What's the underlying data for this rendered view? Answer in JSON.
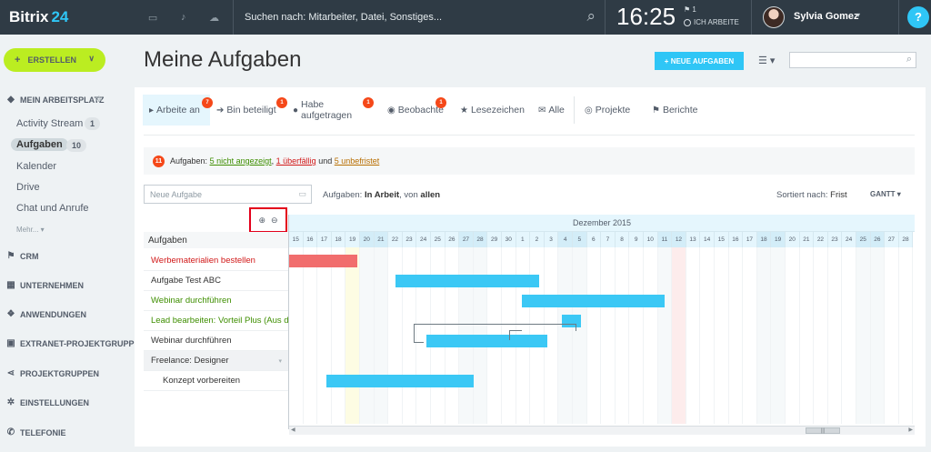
{
  "topbar": {
    "logo_text": "Bitrix",
    "logo_num": "24",
    "search_placeholder": "Suchen nach: Mitarbeiter, Datei, Sonstiges...",
    "clock": "16:25",
    "flag_count": "1",
    "work_status": "ICH ARBEITE",
    "user_name": "Sylvia Gomez",
    "help_label": "?"
  },
  "sidebar": {
    "create_label": "ERSTELLEN",
    "section_workspace": "MEIN ARBEITSPLATZ",
    "items": [
      {
        "label": "Activity Stream",
        "count": "1"
      },
      {
        "label": "Aufgaben",
        "count": "10"
      },
      {
        "label": "Kalender"
      },
      {
        "label": "Drive"
      },
      {
        "label": "Chat und Anrufe"
      }
    ],
    "more_label": "Mehr...",
    "sections": [
      "CRM",
      "UNTERNEHMEN",
      "ANWENDUNGEN",
      "EXTRANET-PROJEKTGRUPPEN",
      "PROJEKTGRUPPEN",
      "EINSTELLUNGEN",
      "TELEFONIE"
    ]
  },
  "header": {
    "title": "Meine Aufgaben",
    "new_task_button": "+ NEUE AUFGABEN"
  },
  "tabs": [
    {
      "label": "Arbeite an",
      "counter": "7",
      "icon": "play-icon"
    },
    {
      "label": "Bin beteiligt",
      "counter": "1",
      "icon": "arrow-icon"
    },
    {
      "label": "Habe aufgetragen",
      "counter": "1",
      "icon": "user-icon"
    },
    {
      "label": "Beobachte",
      "counter": "1",
      "icon": "eye-icon"
    },
    {
      "label": "Lesezeichen",
      "icon": "star-icon"
    },
    {
      "label": "Alle",
      "icon": "mail-icon"
    },
    {
      "label": "Projekte",
      "icon": "compass-icon"
    },
    {
      "label": "Berichte",
      "icon": "flag-icon"
    }
  ],
  "alert": {
    "count": "11",
    "prefix": "Aufgaben:",
    "link1": "5 nicht angezeigt",
    "sep1": ",",
    "link2": "1 überfällig",
    "sep2": "und",
    "link3": "5 unbefristet"
  },
  "toolbar": {
    "new_task_placeholder": "Neue Aufgabe",
    "filter_prefix": "Aufgaben:",
    "filter_status": "In Arbeit",
    "filter_von": ", von",
    "filter_owner": "allen",
    "sort_prefix": "Sortiert nach:",
    "sort_value": "Frist",
    "view_label": "GANTT"
  },
  "gantt": {
    "tasks_header": "Aufgaben",
    "month_label": "Dezember 2015",
    "days": [
      "15",
      "16",
      "17",
      "18",
      "19",
      "20",
      "21",
      "22",
      "23",
      "24",
      "25",
      "26",
      "27",
      "28",
      "29",
      "30",
      "1",
      "2",
      "3",
      "4",
      "5",
      "6",
      "7",
      "8",
      "9",
      "10",
      "11",
      "12",
      "13",
      "14",
      "15",
      "16",
      "17",
      "18",
      "19",
      "20",
      "21",
      "22",
      "23",
      "24",
      "25",
      "26",
      "27",
      "28"
    ],
    "weekend_indices": [
      5,
      6,
      12,
      13,
      19,
      20,
      26,
      27,
      33,
      34,
      40,
      41
    ],
    "today_index": 4,
    "holiday_index": 27,
    "tasks": [
      {
        "name": "Werbematerialien bestellen",
        "style": "red",
        "bar": {
          "start": 0,
          "end": 4.8,
          "color": "red"
        }
      },
      {
        "name": "Aufgabe Test ABC",
        "style": "normal",
        "bar": {
          "start": 7.5,
          "end": 17.6,
          "color": "blue"
        }
      },
      {
        "name": "Webinar durchführen",
        "style": "green",
        "bar": {
          "start": 16.4,
          "end": 26.5,
          "color": "blue"
        }
      },
      {
        "name": "Lead bearbeiten: Vorteil Plus (Aus der",
        "style": "green",
        "bar": {
          "start": 19.2,
          "end": 20.6,
          "color": "blue"
        }
      },
      {
        "name": "Webinar durchführen",
        "style": "normal",
        "bar": {
          "start": 9.7,
          "end": 18.2,
          "color": "blue"
        }
      },
      {
        "name": "Freelance: Designer",
        "style": "group"
      },
      {
        "name": "Konzept vorbereiten",
        "style": "sub",
        "bar": {
          "start": 2.6,
          "end": 13.0,
          "color": "blue"
        }
      }
    ]
  }
}
